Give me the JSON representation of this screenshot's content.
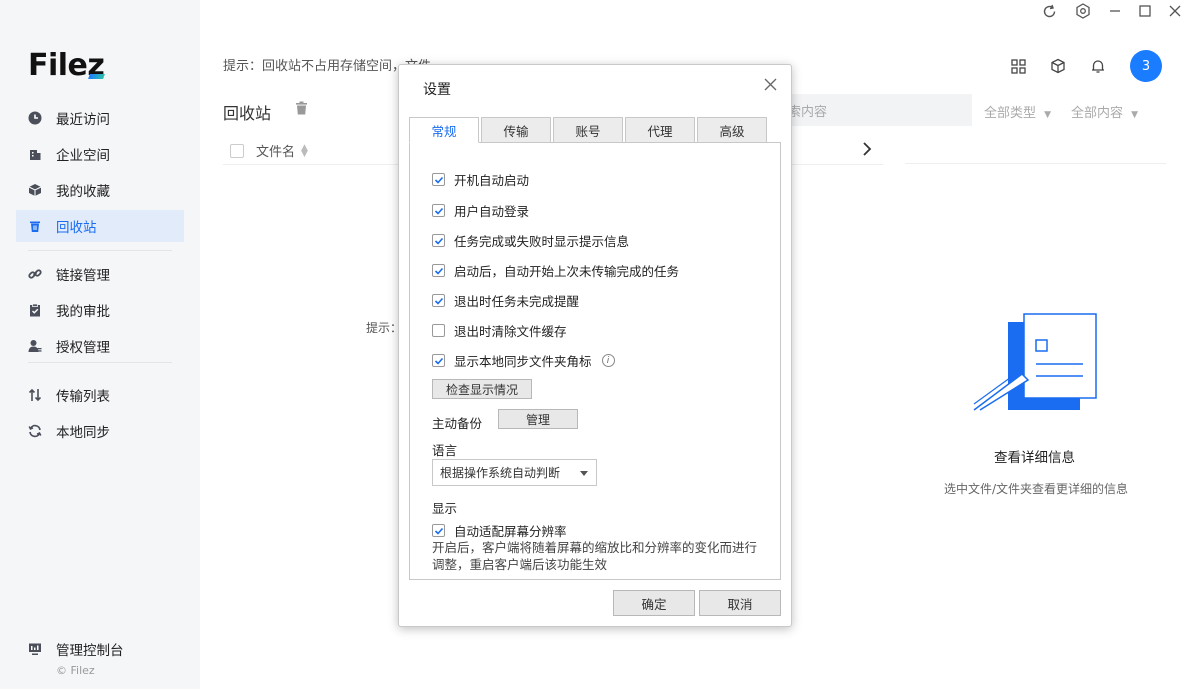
{
  "sidebar": {
    "logo": "Filez",
    "items": [
      {
        "label": "最近访问",
        "icon": "clock-icon"
      },
      {
        "label": "企业空间",
        "icon": "building-icon"
      },
      {
        "label": "我的收藏",
        "icon": "cube-icon"
      },
      {
        "label": "回收站",
        "icon": "trash-icon",
        "active": true
      },
      {
        "label": "链接管理",
        "icon": "link-icon"
      },
      {
        "label": "我的审批",
        "icon": "clipboard-icon"
      },
      {
        "label": "授权管理",
        "icon": "user-key-icon"
      },
      {
        "label": "传输列表",
        "icon": "transfer-icon"
      },
      {
        "label": "本地同步",
        "icon": "sync-icon"
      }
    ],
    "admin_label": "管理控制台",
    "copyright": "© Filez"
  },
  "header": {
    "avatar": "3"
  },
  "main": {
    "tip": "提示：回收站不占用存储空间，文件",
    "title": "回收站",
    "column_filename": "文件名",
    "search_placeholder": "索内容",
    "filter_type": "全部类型",
    "filter_content": "全部内容",
    "empty_tip": "提示："
  },
  "detail": {
    "title": "查看详细信息",
    "subtitle": "选中文件/文件夹查看更详细的信息"
  },
  "dialog": {
    "title": "设置",
    "tabs": [
      "常规",
      "传输",
      "账号",
      "代理",
      "高级"
    ],
    "options": [
      {
        "label": "开机自动启动",
        "checked": true
      },
      {
        "label": "用户自动登录",
        "checked": true
      },
      {
        "label": "任务完成或失败时显示提示信息",
        "checked": true
      },
      {
        "label": "启动后，自动开始上次未传输完成的任务",
        "checked": true
      },
      {
        "label": "退出时任务未完成提醒",
        "checked": true
      },
      {
        "label": "退出时清除文件缓存",
        "checked": false
      },
      {
        "label": "显示本地同步文件夹角标",
        "checked": true
      }
    ],
    "check_display_btn": "检查显示情况",
    "backup_label": "主动备份",
    "manage_btn": "管理",
    "language_label": "语言",
    "language_value": "根据操作系统自动判断",
    "display_label": "显示",
    "auto_fit_label": "自动适配屏幕分辨率",
    "auto_fit_checked": true,
    "auto_fit_desc": "开启后，客户端将随着屏幕的缩放比和分辨率的变化而进行调整，重启客户端后该功能生效",
    "ok_btn": "确定",
    "cancel_btn": "取消"
  }
}
